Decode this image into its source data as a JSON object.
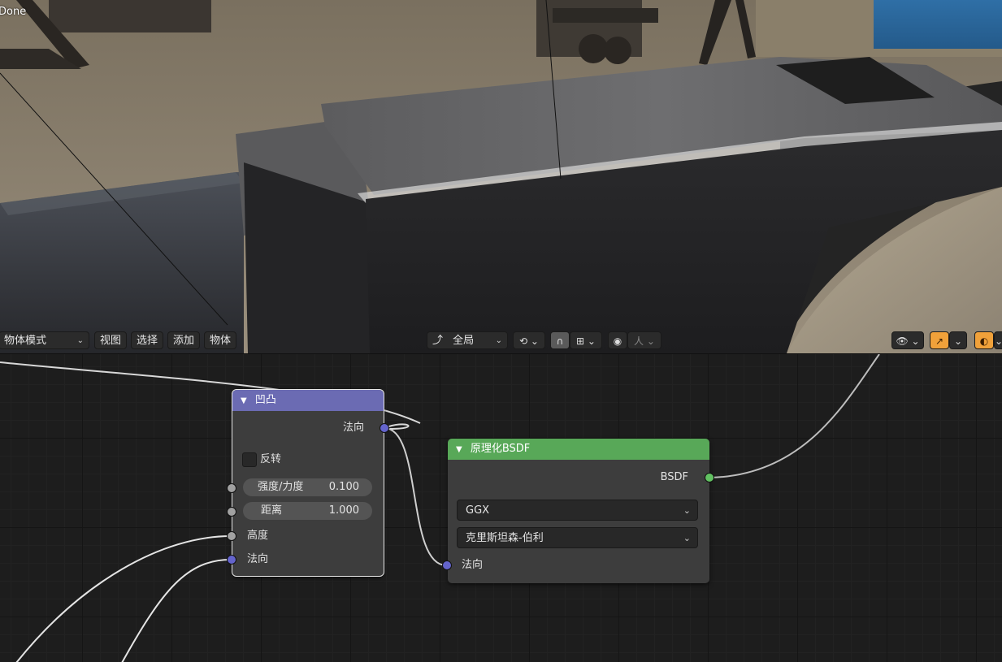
{
  "viewport": {
    "status_text": "Done",
    "header": {
      "mode_label": "物体模式",
      "menu_view": "视图",
      "menu_select": "选择",
      "menu_add": "添加",
      "menu_object": "物体",
      "transform_orientation": "全局",
      "proportional_label": "人"
    }
  },
  "node_editor": {
    "bump_node": {
      "title": "凹凸",
      "output_normal": "法向",
      "invert_label": "反转",
      "strength_label": "强度/力度",
      "strength_value": "0.100",
      "distance_label": "距离",
      "distance_value": "1.000",
      "input_height": "高度",
      "input_normal": "法向",
      "header_color": "#6b6bb3"
    },
    "bsdf_node": {
      "title": "原理化BSDF",
      "output_bsdf": "BSDF",
      "distribution": "GGX",
      "subsurface_method": "克里斯坦森-伯利",
      "input_normal": "法向",
      "header_color": "#58a858"
    }
  }
}
